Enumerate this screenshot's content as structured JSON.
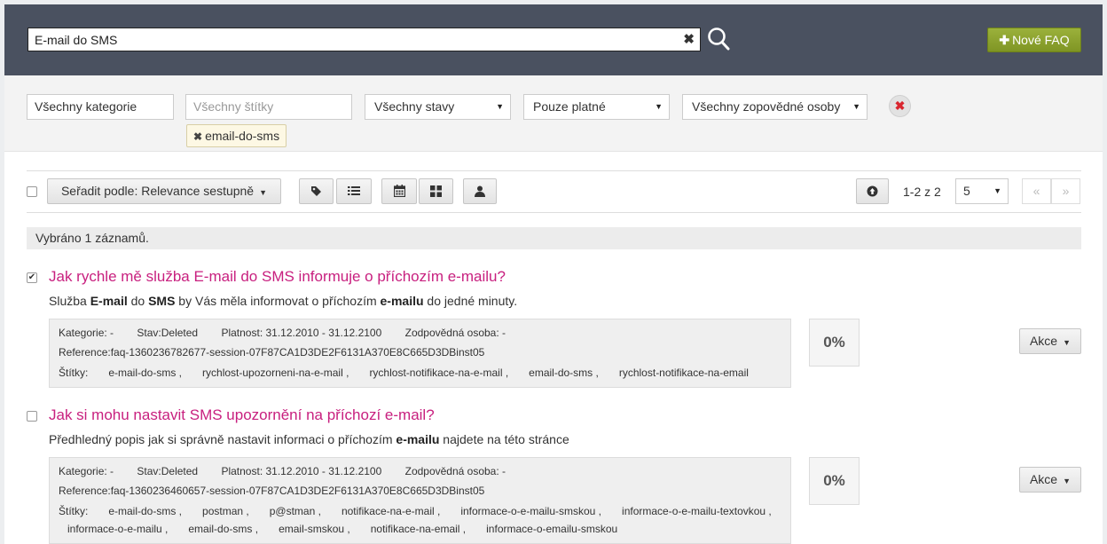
{
  "header": {
    "search_value": "E-mail do SMS",
    "clear_symbol": "✖",
    "new_faq_label": "Nové FAQ",
    "new_faq_plus": "✚"
  },
  "filters": {
    "category": "Všechny kategorie",
    "tags_placeholder": "Všechny štítky",
    "state": "Všechny stavy",
    "validity": "Pouze platné",
    "responsible": "Všechny zopovědné osoby",
    "active_tag": "email-do-sms",
    "reset_symbol": "✖"
  },
  "toolbar": {
    "sort_label": "Seřadit podle: Relevance sestupně",
    "pager_info": "1-2 z 2",
    "page_size": "5",
    "prev": "«",
    "next": "»"
  },
  "selection": {
    "text": "Vybráno 1 záznamů."
  },
  "items": [
    {
      "checked": true,
      "title": "Jak rychle mě služba E-mail do SMS informuje o příchozím e-mailu?",
      "desc": [
        {
          "t": "Služba "
        },
        {
          "t": "E-mail",
          "b": true
        },
        {
          "t": " do "
        },
        {
          "t": "SMS",
          "b": true
        },
        {
          "t": " by Vás měla informovat o příchozím "
        },
        {
          "t": "e-mailu",
          "b": true
        },
        {
          "t": " do jedné minuty."
        }
      ],
      "kategorie": "Kategorie: -",
      "stav": "Stav:Deleted",
      "platnost": "Platnost: 31.12.2010 - 31.12.2100",
      "osoba": "Zodpovědná osoba: -",
      "reference": "Reference:faq-1360236782677-session-07F87CA1D3DE2F6131A370E8C665D3DBinst05",
      "tags_label": "Štítky:",
      "tags": [
        "e-mail-do-sms ,",
        "rychlost-upozorneni-na-e-mail ,",
        "rychlost-notifikace-na-e-mail ,",
        "email-do-sms ,",
        "rychlost-notifikace-na-email"
      ],
      "percent": "0%",
      "action": "Akce"
    },
    {
      "checked": false,
      "title": "Jak si mohu nastavit SMS upozornění na příchozí e-mail?",
      "desc": [
        {
          "t": "Předhledný popis jak si správně nastavit informaci o příchozím "
        },
        {
          "t": "e-mailu",
          "b": true
        },
        {
          "t": " najdete na této stránce"
        }
      ],
      "kategorie": "Kategorie: -",
      "stav": "Stav:Deleted",
      "platnost": "Platnost: 31.12.2010 - 31.12.2100",
      "osoba": "Zodpovědná osoba: -",
      "reference": "Reference:faq-1360236460657-session-07F87CA1D3DE2F6131A370E8C665D3DBinst05",
      "tags_label": "Štítky:",
      "tags": [
        "e-mail-do-sms ,",
        "postman ,",
        "p@stman ,",
        "notifikace-na-e-mail ,",
        "informace-o-e-mailu-smskou ,",
        "informace-o-e-mailu-textovkou ,"
      ],
      "tags2": [
        "informace-o-e-mailu ,",
        "email-do-sms ,",
        "email-smskou ,",
        "notifikace-na-email ,",
        "informace-o-emailu-smskou"
      ],
      "percent": "0%",
      "action": "Akce"
    }
  ]
}
